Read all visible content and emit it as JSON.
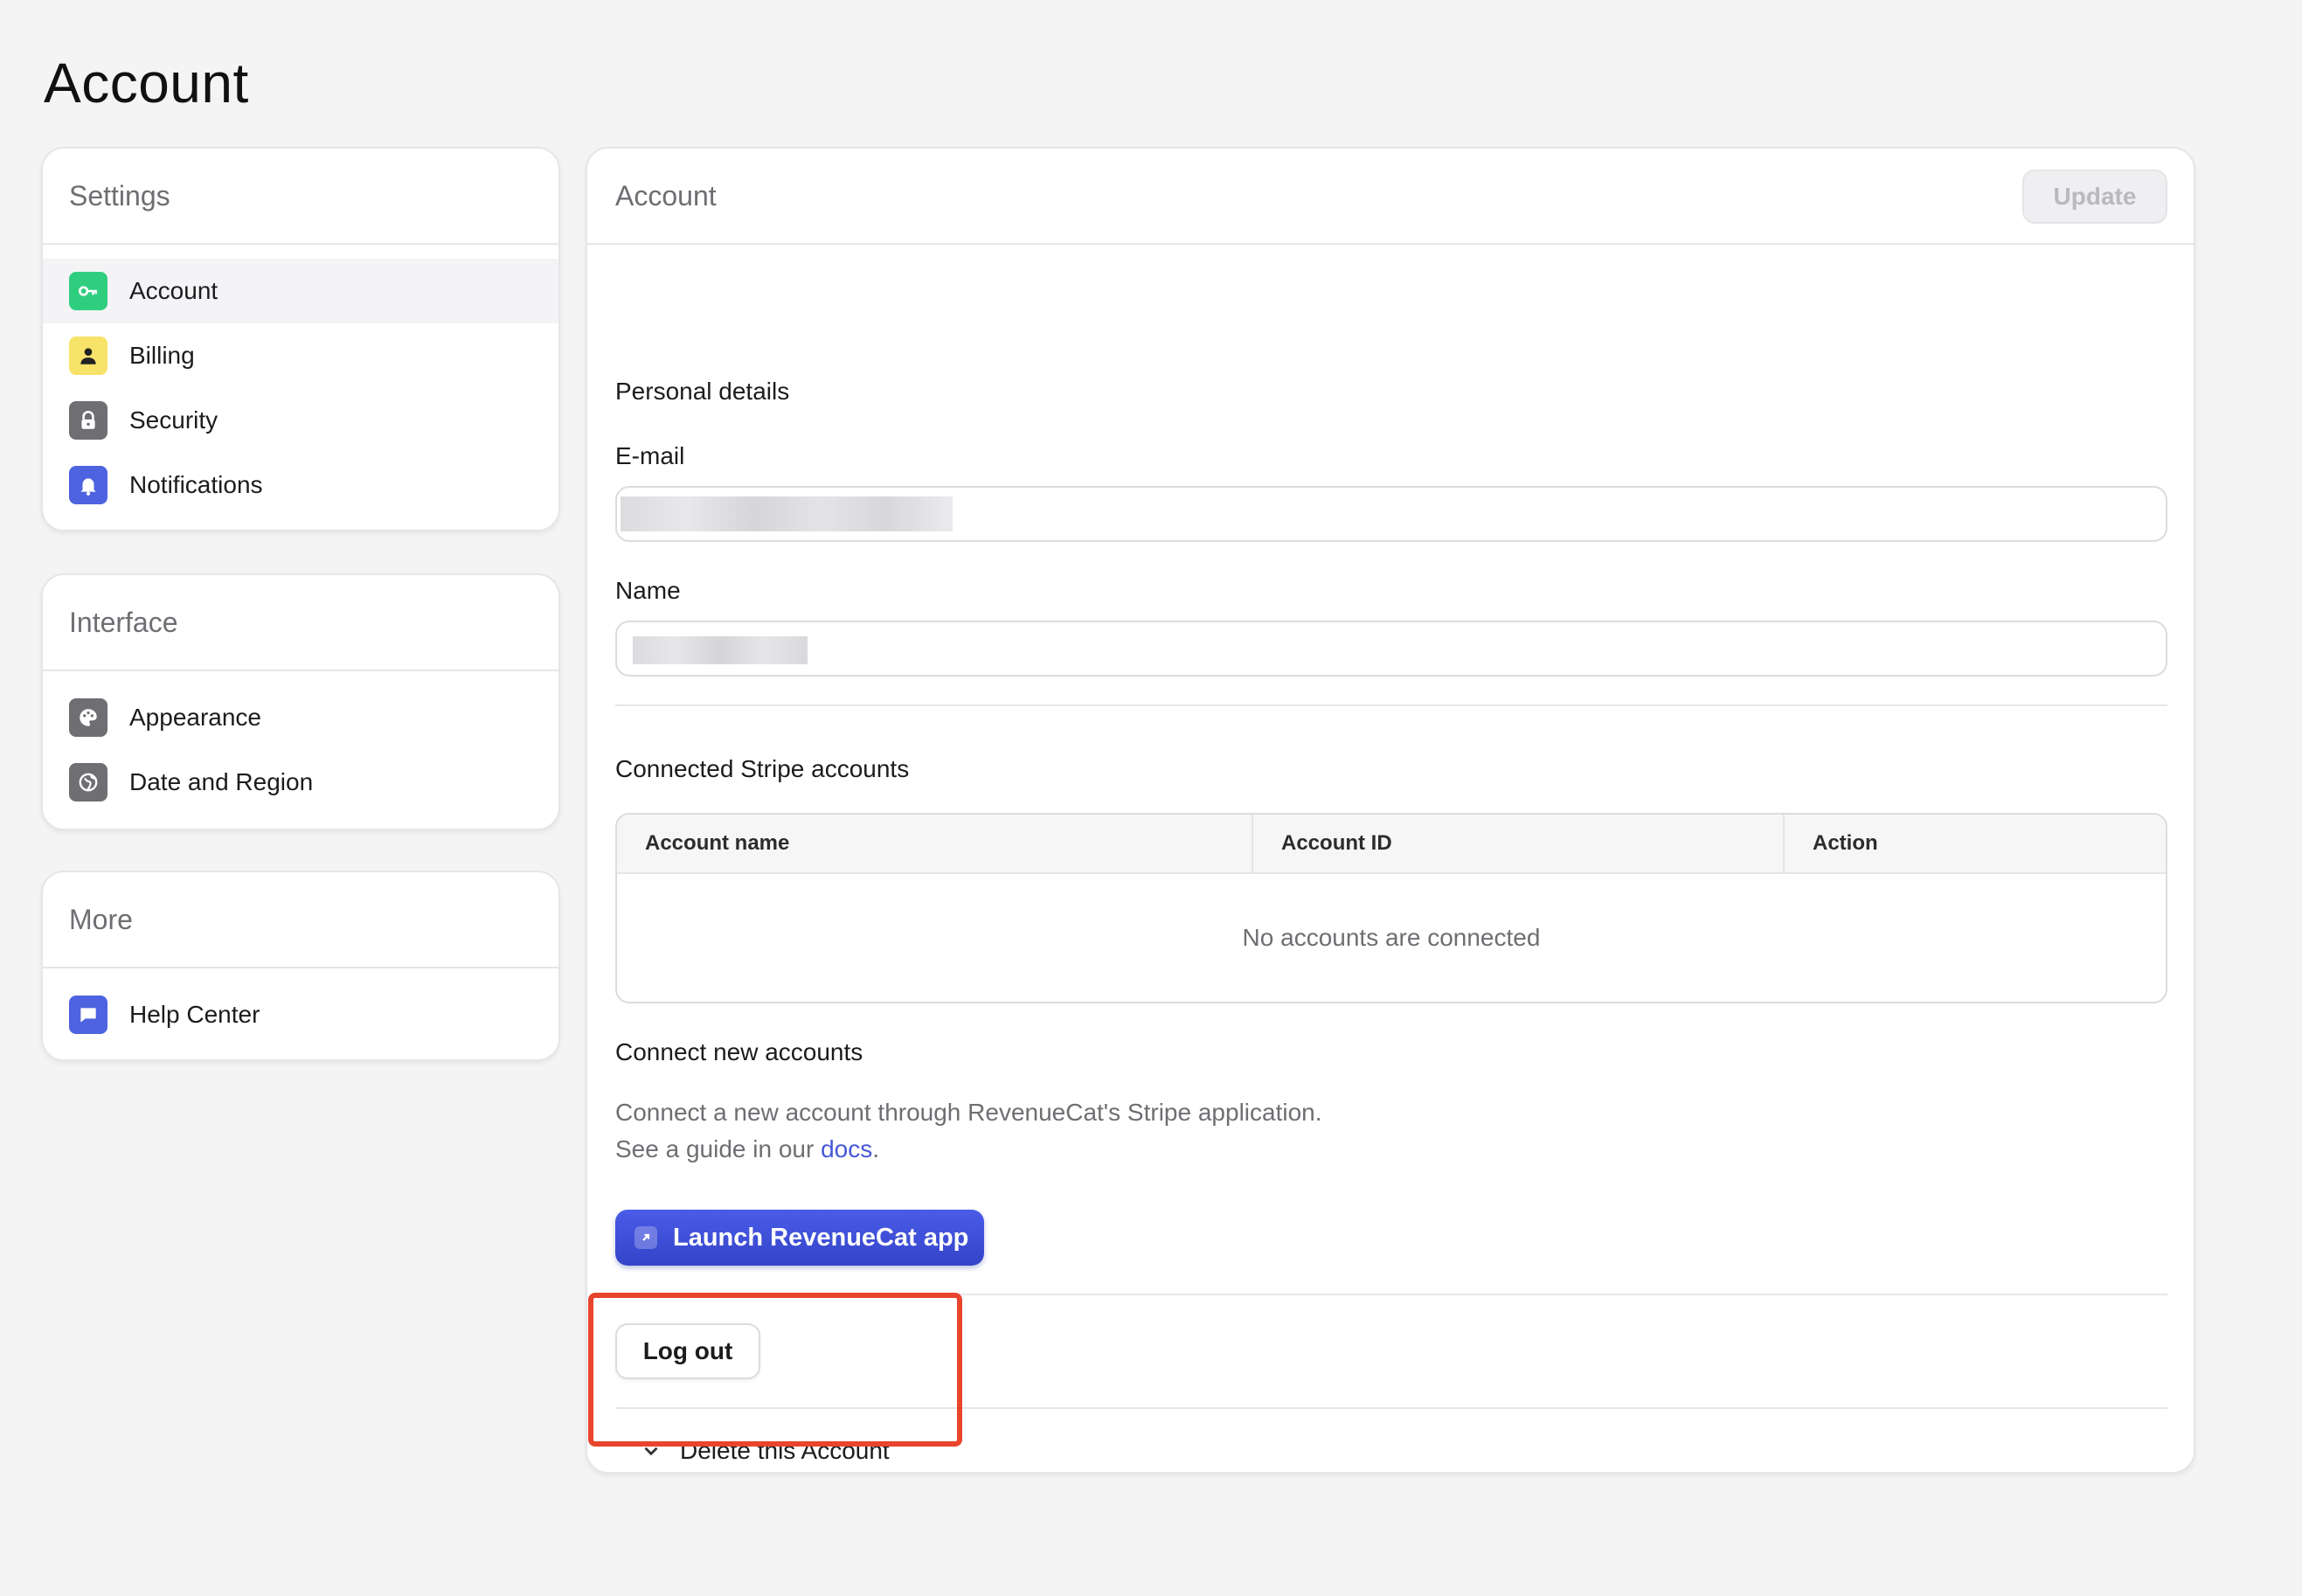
{
  "page": {
    "title": "Account"
  },
  "sidebar": {
    "settings": {
      "heading": "Settings",
      "items": [
        {
          "label": "Account",
          "icon": "key-icon",
          "color": "#2fce7f",
          "active": true
        },
        {
          "label": "Billing",
          "icon": "person-icon",
          "color": "#f7e36a",
          "active": false
        },
        {
          "label": "Security",
          "icon": "lock-icon",
          "color": "#6e6e73",
          "active": false
        },
        {
          "label": "Notifications",
          "icon": "bell-icon",
          "color": "#4d63e0",
          "active": false
        }
      ]
    },
    "interface": {
      "heading": "Interface",
      "items": [
        {
          "label": "Appearance",
          "icon": "palette-icon",
          "color": "#6e6e73"
        },
        {
          "label": "Date and Region",
          "icon": "globe-icon",
          "color": "#6e6e73"
        }
      ]
    },
    "more": {
      "heading": "More",
      "items": [
        {
          "label": "Help Center",
          "icon": "chat-icon",
          "color": "#4d63e0"
        }
      ]
    }
  },
  "main": {
    "heading": "Account",
    "update_label": "Update",
    "personal_details": "Personal details",
    "email_label": "E-mail",
    "name_label": "Name",
    "stripe_heading": "Connected Stripe accounts",
    "table": {
      "columns": [
        "Account name",
        "Account ID",
        "Action"
      ],
      "empty_text": "No accounts are connected"
    },
    "connect_heading": "Connect new accounts",
    "connect_desc_line1": "Connect a new account through RevenueCat's Stripe application.",
    "connect_desc_line2_prefix": "See a guide in our ",
    "connect_docs_link": "docs",
    "connect_desc_line2_suffix": ".",
    "launch_label": "Launch RevenueCat app",
    "logout_label": "Log out",
    "delete_label": "Delete this Account"
  },
  "colors": {
    "accent": "#4658d8",
    "highlight": "#e8452c"
  }
}
